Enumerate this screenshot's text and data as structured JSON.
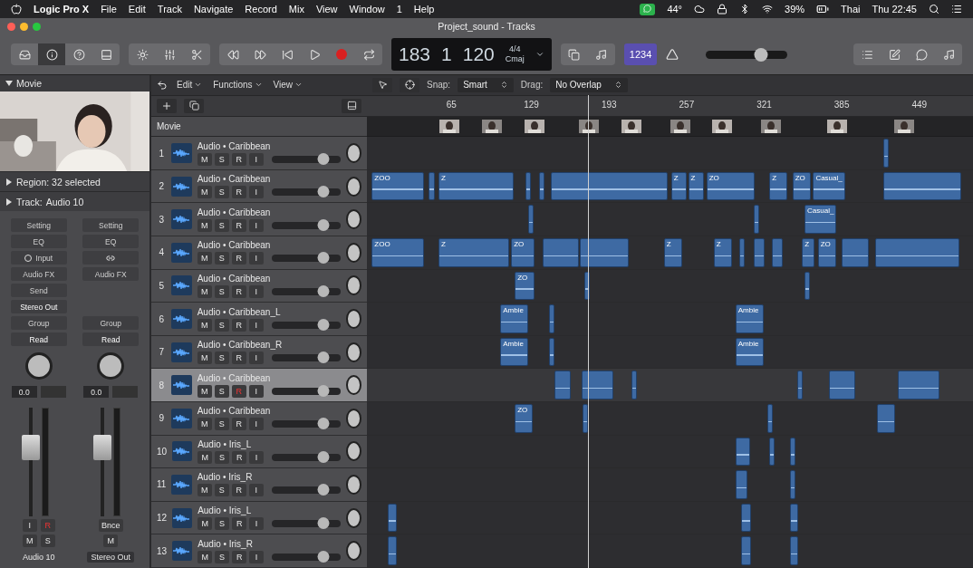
{
  "menu_bar": {
    "app": "Logic Pro X",
    "menus": [
      "File",
      "Edit",
      "Track",
      "Navigate",
      "Record",
      "Mix",
      "View",
      "Window",
      "1",
      "Help"
    ],
    "status": {
      "weather": "44°",
      "battery": "39%",
      "input_source": "Thai",
      "clock": "Thu 22:45"
    }
  },
  "window": {
    "title": "Project_sound - Tracks"
  },
  "toolbar": {
    "lcd": {
      "bar": "183",
      "beat": "1",
      "tempo": "120",
      "signature": "4/4",
      "key": "Cmaj"
    },
    "count_in": {
      "label": "1234",
      "selected": true
    },
    "master_volume": {
      "level": 0.68
    }
  },
  "arrange_toolbar": {
    "menus": [
      "Edit",
      "Functions",
      "View"
    ],
    "snap_label": "Snap:",
    "snap": "Smart",
    "drag_label": "Drag:",
    "drag": "No Overlap"
  },
  "ruler": [
    "65",
    "129",
    "193",
    "257",
    "321",
    "385",
    "449"
  ],
  "inspector": {
    "title": "Movie",
    "region": "Region: 32 selected",
    "track_label": "Track:",
    "track": "Audio 10"
  },
  "channel_strips": [
    {
      "kind": "track",
      "setting": "Setting",
      "eq": "EQ",
      "input": "Input",
      "audio_fx": "Audio FX",
      "send": "Send",
      "output": "Stereo Out",
      "group": "Group",
      "automation": "Read",
      "volume": "0.0",
      "input_monitor": "I",
      "record": "R",
      "record_on": true,
      "mute": "M",
      "solo": "S",
      "name": "Audio 10"
    },
    {
      "kind": "output",
      "setting": "Setting",
      "eq": "EQ",
      "audio_fx": "Audio FX",
      "group": "Group",
      "automation": "Read",
      "volume": "0.0",
      "bounce": "Bnce",
      "mute": "M",
      "name": "Stereo Out"
    }
  ],
  "tracks_header": {
    "movie_label": "Movie"
  },
  "tracks": [
    {
      "number": "1",
      "name": "Audio • Caribbean",
      "selected": false,
      "mute": "M",
      "solo": "S",
      "record": "R",
      "input": "I",
      "record_on": false,
      "level": 0.75
    },
    {
      "number": "2",
      "name": "Audio • Caribbean",
      "selected": false,
      "mute": "M",
      "solo": "S",
      "record": "R",
      "input": "I",
      "record_on": false,
      "level": 0.75,
      "regions": [
        {
          "label": "ZOO"
        },
        {
          "label": "Z"
        },
        {
          "label": "Z"
        },
        {
          "label": "Z"
        },
        {
          "label": "ZO"
        },
        {
          "label": "Z"
        },
        {
          "label": "ZO"
        },
        {
          "label": "Casual_"
        }
      ]
    },
    {
      "number": "3",
      "name": "Audio • Caribbean",
      "selected": false,
      "mute": "M",
      "solo": "S",
      "record": "R",
      "input": "I",
      "record_on": false,
      "level": 0.75,
      "regions": [
        {
          "label": "Casual_"
        }
      ]
    },
    {
      "number": "4",
      "name": "Audio • Caribbean",
      "selected": false,
      "mute": "M",
      "solo": "S",
      "record": "R",
      "input": "I",
      "record_on": false,
      "level": 0.75,
      "regions": [
        {
          "label": "ZOO"
        },
        {
          "label": "Z"
        },
        {
          "label": "ZO"
        },
        {
          "label": "Z"
        },
        {
          "label": "Z"
        },
        {
          "label": "Z"
        },
        {
          "label": "ZO"
        }
      ]
    },
    {
      "number": "5",
      "name": "Audio • Caribbean",
      "selected": false,
      "mute": "M",
      "solo": "S",
      "record": "R",
      "input": "I",
      "record_on": false,
      "level": 0.75,
      "regions": [
        {
          "label": "ZO"
        }
      ]
    },
    {
      "number": "6",
      "name": "Audio • Caribbean_L",
      "selected": false,
      "mute": "M",
      "solo": "S",
      "record": "R",
      "input": "I",
      "record_on": false,
      "level": 0.75,
      "regions": [
        {
          "label": "Ambie"
        },
        {
          "label": "Ambie"
        }
      ]
    },
    {
      "number": "7",
      "name": "Audio • Caribbean_R",
      "selected": false,
      "mute": "M",
      "solo": "S",
      "record": "R",
      "input": "I",
      "record_on": false,
      "level": 0.75,
      "regions": [
        {
          "label": "Ambie"
        },
        {
          "label": "Ambie"
        }
      ]
    },
    {
      "number": "8",
      "name": "Audio • Caribbean",
      "selected": true,
      "mute": "M",
      "solo": "S",
      "record": "R",
      "input": "I",
      "record_on": true,
      "level": 0.75
    },
    {
      "number": "9",
      "name": "Audio • Caribbean",
      "selected": false,
      "mute": "M",
      "solo": "S",
      "record": "R",
      "input": "I",
      "record_on": false,
      "level": 0.75,
      "regions": [
        {
          "label": "ZO"
        }
      ]
    },
    {
      "number": "10",
      "name": "Audio • Iris_L",
      "selected": false,
      "mute": "M",
      "solo": "S",
      "record": "R",
      "input": "I",
      "record_on": false,
      "level": 0.75
    },
    {
      "number": "11",
      "name": "Audio • Iris_R",
      "selected": false,
      "mute": "M",
      "solo": "S",
      "record": "R",
      "input": "I",
      "record_on": false,
      "level": 0.75
    },
    {
      "number": "12",
      "name": "Audio • Iris_L",
      "selected": false,
      "mute": "M",
      "solo": "S",
      "record": "R",
      "input": "I",
      "record_on": false,
      "level": 0.75
    },
    {
      "number": "13",
      "name": "Audio • Iris_R",
      "selected": false,
      "mute": "M",
      "solo": "S",
      "record": "R",
      "input": "I",
      "record_on": false,
      "level": 0.75
    }
  ]
}
